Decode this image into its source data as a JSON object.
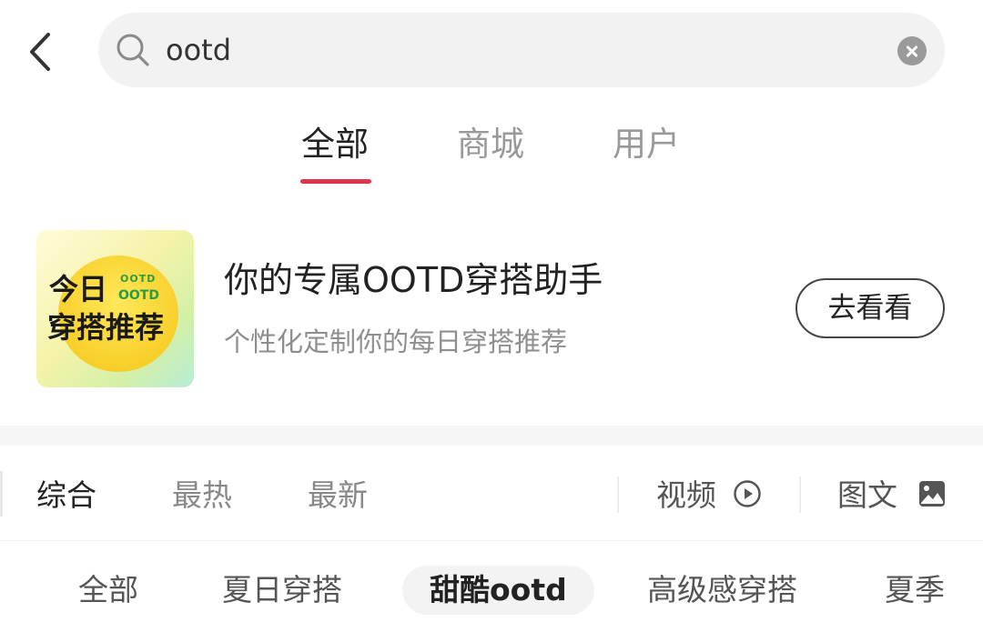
{
  "search": {
    "query": "ootd"
  },
  "scope_tabs": [
    {
      "label": "全部",
      "active": true
    },
    {
      "label": "商城",
      "active": false
    },
    {
      "label": "用户",
      "active": false
    }
  ],
  "promo": {
    "thumb_line1": "今日",
    "thumb_line2": "穿搭推荐",
    "thumb_sub": "OOTD",
    "thumb_badge": "OOTD",
    "title": "你的专属OOTD穿搭助手",
    "description": "个性化定制你的每日穿搭推荐",
    "button_label": "去看看"
  },
  "sort_bar": {
    "items": [
      {
        "label": "综合",
        "active": true
      },
      {
        "label": "最热",
        "active": false
      },
      {
        "label": "最新",
        "active": false
      }
    ],
    "video_filter": "视频",
    "image_filter": "图文"
  },
  "tags": [
    {
      "label": "全部",
      "active": false
    },
    {
      "label": "夏日穿搭",
      "active": false
    },
    {
      "label": "甜酷ootd",
      "active": true
    },
    {
      "label": "高级感穿搭",
      "active": false
    },
    {
      "label": "夏季",
      "active": false
    }
  ],
  "colors": {
    "accent": "#e0344a",
    "thumb_green": "#2e9a44",
    "thumb_yellow": "#f8cf2a"
  }
}
